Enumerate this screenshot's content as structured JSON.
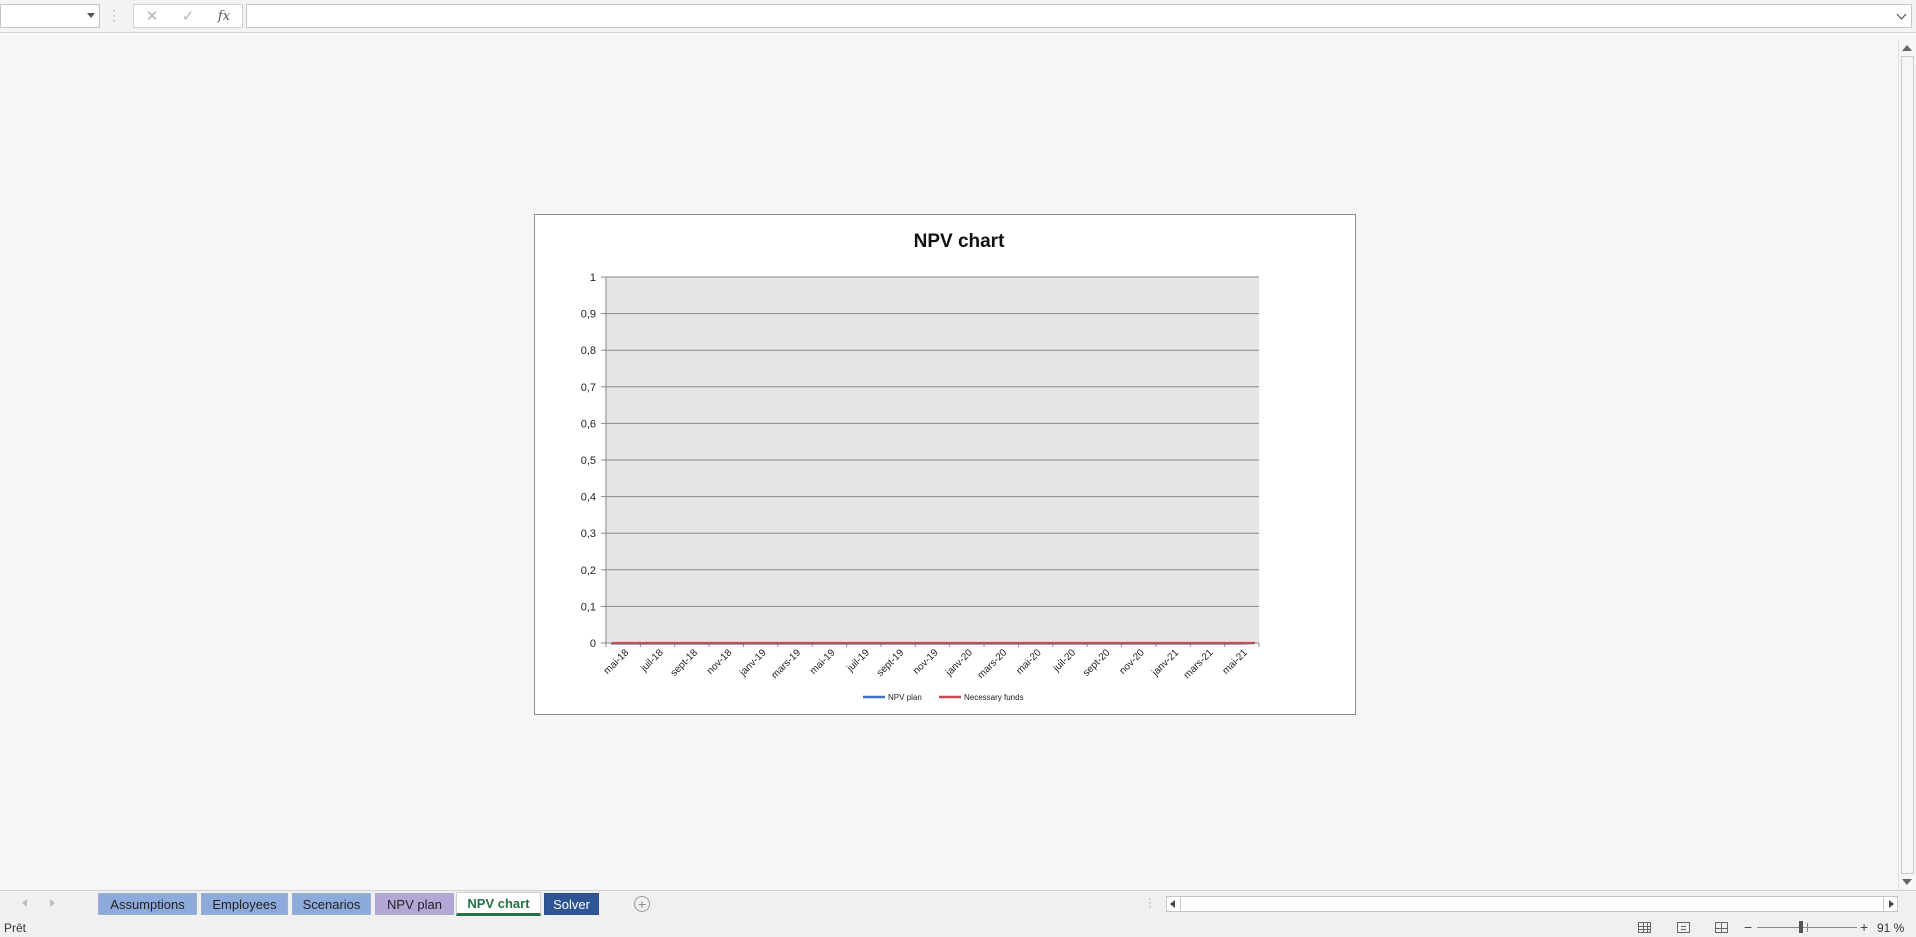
{
  "formula_bar": {
    "namebox_value": "",
    "cancel_icon": "✕",
    "enter_icon": "✓",
    "fx_label": "fx",
    "formula_value": ""
  },
  "sheet_tabs": [
    {
      "label": "Assumptions",
      "color": "#8eaadb",
      "active": false
    },
    {
      "label": "Employees",
      "color": "#8eaadb",
      "active": false
    },
    {
      "label": "Scenarios",
      "color": "#8eaadb",
      "active": false
    },
    {
      "label": "NPV plan",
      "color": "#b4a7d6",
      "active": false
    },
    {
      "label": "NPV chart",
      "color": "#ffffff",
      "active": true
    },
    {
      "label": "Solver",
      "color": "#2f5597",
      "active": false
    }
  ],
  "status": {
    "ready_text": "Prêt",
    "zoom_level": "91 %",
    "zoom_minus": "−",
    "zoom_plus": "+"
  },
  "chart_data": {
    "type": "line",
    "title": "NPV chart",
    "xlabel": "",
    "ylabel": "",
    "ylim": [
      0,
      1
    ],
    "y_ticks": [
      "1",
      "0,9",
      "0,8",
      "0,7",
      "0,6",
      "0,5",
      "0,4",
      "0,3",
      "0,2",
      "0,1",
      "0"
    ],
    "categories": [
      "mai-18",
      "juil-18",
      "sept-18",
      "nov-18",
      "janv-19",
      "mars-19",
      "mai-19",
      "juil-19",
      "sept-19",
      "nov-19",
      "janv-20",
      "mars-20",
      "mai-20",
      "juil-20",
      "sept-20",
      "nov-20",
      "janv-21",
      "mars-21",
      "mai-21"
    ],
    "series": [
      {
        "name": "NPV plan",
        "color": "#4472c4",
        "values": [
          0,
          0,
          0,
          0,
          0,
          0,
          0,
          0,
          0,
          0,
          0,
          0,
          0,
          0,
          0,
          0,
          0,
          0,
          0
        ]
      },
      {
        "name": "Necessary funds",
        "color": "#c0504d",
        "values": [
          0,
          0,
          0,
          0,
          0,
          0,
          0,
          0,
          0,
          0,
          0,
          0,
          0,
          0,
          0,
          0,
          0,
          0,
          0
        ]
      }
    ],
    "grid": true,
    "legend": "bottom",
    "plot_background": "#e6e6e6"
  }
}
